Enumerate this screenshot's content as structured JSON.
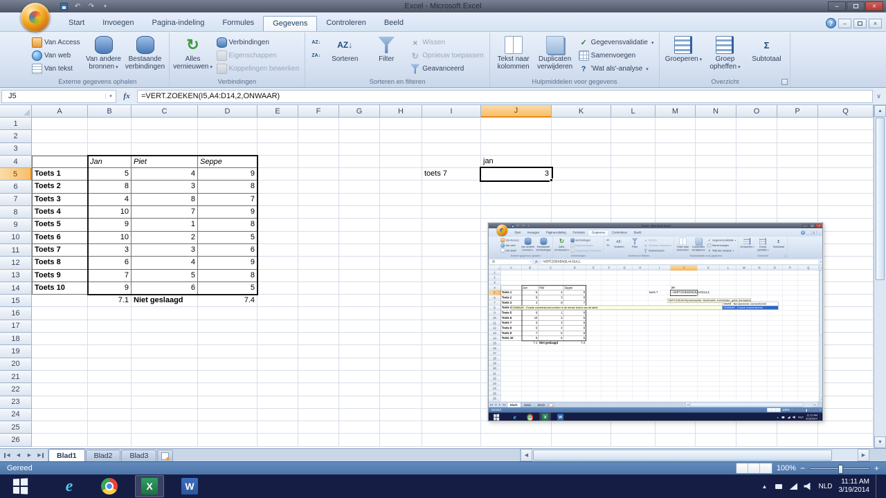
{
  "icons": {
    "dropdown": "▾",
    "minimize": "–",
    "close": "×",
    "help": "?",
    "scroll_up": "▲",
    "scroll_down": "▼",
    "scroll_left": "◀",
    "scroll_right": "▶",
    "tray_expand": "▲",
    "zoom_minus": "−",
    "zoom_plus": "+",
    "formula_expand": "∨",
    "fx": "fx"
  },
  "icon_glyphs": {
    "refresh": "↻",
    "reapply": "↻",
    "sort-az-small": "AZ↓",
    "sort-za-small": "ZA↓",
    "sort-large": "AZ↓",
    "clear-filter": "×",
    "data-validation": "✓",
    "what-if": "?",
    "subtotal": "Σ",
    "undo": "↶",
    "redo": "↷",
    "excel-app": "X",
    "word-app": "W",
    "internet-explorer": "e"
  },
  "window": {
    "title": "Excel - Microsoft Excel"
  },
  "ribbon": {
    "active_tab": "Gegevens",
    "tabs": [
      "Start",
      "Invoegen",
      "Pagina-indeling",
      "Formules",
      "Gegevens",
      "Controleren",
      "Beeld"
    ],
    "groups": [
      {
        "label": "Externe gegevens ophalen",
        "items": [
          {
            "label": "Van Access",
            "type": "small",
            "icon": "access-db"
          },
          {
            "label": "Van web",
            "type": "small",
            "icon": "web-globe"
          },
          {
            "label": "Van tekst",
            "type": "small",
            "icon": "text-file"
          },
          {
            "label": "Van andere bronnen",
            "type": "large",
            "icon": "other-sources",
            "arrow": true
          },
          {
            "label": "Bestaande verbindingen",
            "type": "large",
            "icon": "existing-connections"
          }
        ]
      },
      {
        "label": "Verbindingen",
        "items": [
          {
            "label": "Alles vernieuwen",
            "type": "large",
            "icon": "refresh",
            "arrow": true
          },
          {
            "label": "Verbindingen",
            "type": "small",
            "icon": "connections"
          },
          {
            "label": "Eigenschappen",
            "type": "small",
            "icon": "properties",
            "disabled": true
          },
          {
            "label": "Koppelingen bewerken",
            "type": "small",
            "icon": "edit-links",
            "disabled": true
          }
        ]
      },
      {
        "label": "Sorteren en filteren",
        "items": [
          {
            "label": "",
            "type": "small",
            "icon": "sort-az-small"
          },
          {
            "label": "",
            "type": "small",
            "icon": "sort-za-small"
          },
          {
            "label": "Sorteren",
            "type": "large",
            "icon": "sort-large"
          },
          {
            "label": "Filter",
            "type": "large",
            "icon": "filter-funnel"
          },
          {
            "label": "Wissen",
            "type": "small",
            "icon": "clear-filter",
            "disabled": true
          },
          {
            "label": "Opnieuw toepassen",
            "type": "small",
            "icon": "reapply",
            "disabled": true
          },
          {
            "label": "Geavanceerd",
            "type": "small",
            "icon": "advanced-filter"
          }
        ]
      },
      {
        "label": "Hulpmiddelen voor gegevens",
        "items": [
          {
            "label": "Tekst naar kolommen",
            "type": "large",
            "icon": "text-to-columns"
          },
          {
            "label": "Duplicaten verwijderen",
            "type": "large",
            "icon": "remove-duplicates"
          },
          {
            "label": "Gegevensvalidatie",
            "type": "small",
            "icon": "data-validation",
            "arrow": true
          },
          {
            "label": "Samenvoegen",
            "type": "small",
            "icon": "consolidate"
          },
          {
            "label": "'Wat als'-analyse",
            "type": "small",
            "icon": "what-if",
            "arrow": true
          }
        ]
      },
      {
        "label": "Overzicht",
        "launcher": true,
        "items": [
          {
            "label": "Groeperen",
            "type": "large",
            "icon": "group",
            "arrow": true
          },
          {
            "label": "Groep opheffen",
            "type": "large",
            "icon": "ungroup",
            "arrow": true
          },
          {
            "label": "Subtotaal",
            "type": "large",
            "icon": "subtotal"
          }
        ]
      }
    ]
  },
  "formula_bar": {
    "name_box": "J5",
    "formula": "=VERT.ZOEKEN(I5,A4:D14,2,ONWAAR)"
  },
  "sheet": {
    "columns": [
      "A",
      "B",
      "C",
      "D",
      "E",
      "F",
      "G",
      "H",
      "I",
      "J",
      "K",
      "L",
      "M",
      "N",
      "O",
      "P",
      "Q"
    ],
    "row_count": 26,
    "selection": {
      "cell": "J5",
      "column": "J",
      "row": 5
    },
    "table": {
      "range": "A4:D14",
      "headers": [
        "Jan",
        "Piet",
        "Seppe"
      ],
      "rows": [
        {
          "label": "Toets 1",
          "values": [
            5,
            4,
            9
          ]
        },
        {
          "label": "Toets 2",
          "values": [
            8,
            3,
            8
          ]
        },
        {
          "label": "Toets 3",
          "values": [
            4,
            8,
            7
          ]
        },
        {
          "label": "Toets 4",
          "values": [
            10,
            7,
            9
          ]
        },
        {
          "label": "Toets 5",
          "values": [
            9,
            1,
            8
          ]
        },
        {
          "label": "Toets 6",
          "values": [
            10,
            2,
            5
          ]
        },
        {
          "label": "Toets 7",
          "values": [
            3,
            3,
            6
          ]
        },
        {
          "label": "Toets 8",
          "values": [
            6,
            4,
            9
          ]
        },
        {
          "label": "Toets 9",
          "values": [
            7,
            5,
            8
          ]
        },
        {
          "label": "Toets 10",
          "values": [
            9,
            6,
            5
          ]
        }
      ],
      "summary": [
        "7.1",
        "Niet geslaagd",
        "7.4"
      ]
    },
    "loose_cells": [
      {
        "ref": "I5",
        "text": "toets 7",
        "align": "left"
      },
      {
        "ref": "J4",
        "text": "jan",
        "align": "left"
      },
      {
        "ref": "J5",
        "text": "3",
        "align": "right"
      }
    ]
  },
  "embedded_screenshot": {
    "formula": "=VERT.ZOEKEN(I5,A4:D14,2,",
    "signature": "VERT.ZOEKEN(zoekwaarde; tabelmatrix; kolomindex_getal; [benaderen])",
    "description": "ONWAAR - Exacte overeenkomst zoeken in de eerste kolom van de tabel",
    "options": [
      "WAAR - Benaderende overeenkomst",
      "ONWAAR - Exacte overeenkomst"
    ],
    "selected_option": "ONWAAR - Exacte overeenkomst"
  },
  "sheet_tabs": {
    "tabs": [
      "Blad1",
      "Blad2",
      "Blad3"
    ],
    "active": "Blad1"
  },
  "status_bar": {
    "status": "Gereed",
    "zoom": "100%"
  },
  "taskbar": {
    "apps": [
      {
        "name": "internet-explorer"
      },
      {
        "name": "chrome"
      },
      {
        "name": "excel-app",
        "active": true
      },
      {
        "name": "word-app"
      }
    ],
    "language": "NLD",
    "time": "11:11 AM",
    "date": "3/19/2014"
  }
}
